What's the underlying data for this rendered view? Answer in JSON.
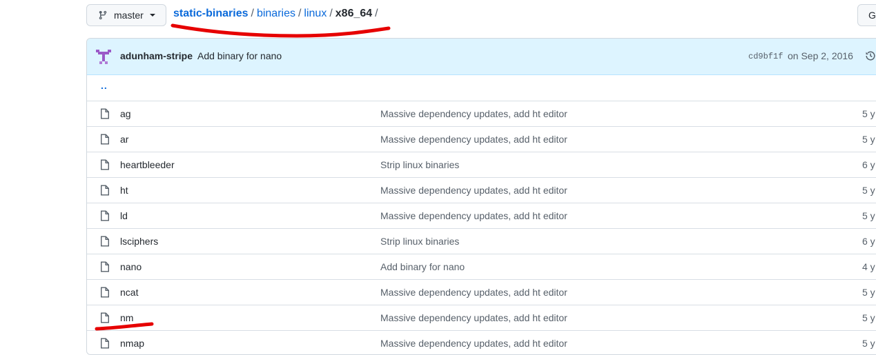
{
  "branch": {
    "label": "master",
    "icon": "git-branch-icon"
  },
  "breadcrumb": {
    "repo": "static-binaries",
    "parts": [
      "binaries",
      "linux"
    ],
    "current": "x86_64",
    "separator": "/"
  },
  "goto_button": {
    "label": "G"
  },
  "commit": {
    "author": "adunham-stripe",
    "message": "Add binary for nano",
    "sha": "cd9bf1f",
    "date": "on Sep 2, 2016"
  },
  "parent_dir": "..",
  "files": [
    {
      "name": "ag",
      "message": "Massive dependency updates, add ht editor",
      "age": "5 y"
    },
    {
      "name": "ar",
      "message": "Massive dependency updates, add ht editor",
      "age": "5 y"
    },
    {
      "name": "heartbleeder",
      "message": "Strip linux binaries",
      "age": "6 y"
    },
    {
      "name": "ht",
      "message": "Massive dependency updates, add ht editor",
      "age": "5 y"
    },
    {
      "name": "ld",
      "message": "Massive dependency updates, add ht editor",
      "age": "5 y"
    },
    {
      "name": "lsciphers",
      "message": "Strip linux binaries",
      "age": "6 y"
    },
    {
      "name": "nano",
      "message": "Add binary for nano",
      "age": "4 y"
    },
    {
      "name": "ncat",
      "message": "Massive dependency updates, add ht editor",
      "age": "5 y"
    },
    {
      "name": "nm",
      "message": "Massive dependency updates, add ht editor",
      "age": "5 y"
    },
    {
      "name": "nmap",
      "message": "Massive dependency updates, add ht editor",
      "age": "5 y"
    }
  ],
  "colors": {
    "link": "#0969da",
    "commit_bg": "#ddf4ff",
    "annotation": "#e60000"
  }
}
